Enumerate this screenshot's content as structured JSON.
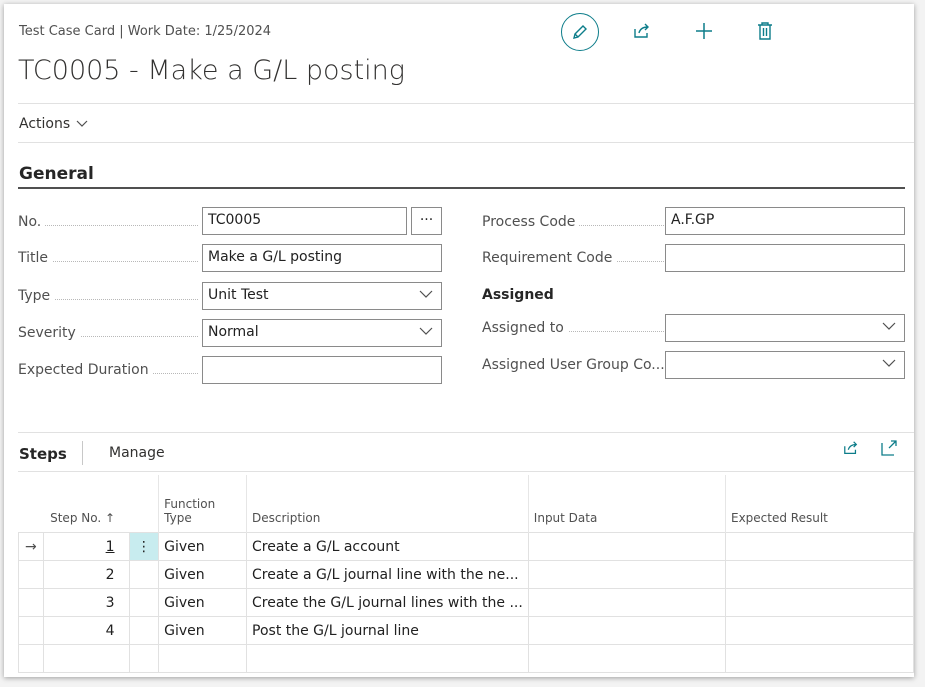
{
  "header": {
    "breadcrumb": "Test Case Card | Work Date: 1/25/2024",
    "title": "TC0005 - Make a G/L posting"
  },
  "actions_label": "Actions",
  "section_title": "General",
  "fields_left": [
    {
      "label": "No.",
      "value": "TC0005"
    },
    {
      "label": "Title",
      "value": "Make a G/L posting"
    },
    {
      "label": "Type",
      "value": "Unit Test"
    },
    {
      "label": "Severity",
      "value": "Normal"
    },
    {
      "label": "Expected Duration",
      "value": ""
    }
  ],
  "fields_right": [
    {
      "label": "Process Code",
      "value": "A.F.GP"
    },
    {
      "label": "Requirement Code",
      "value": ""
    },
    {
      "label": "Assigned to",
      "value": ""
    },
    {
      "label": "Assigned User Group Co...",
      "value": ""
    }
  ],
  "assigned_heading": "Assigned",
  "lookup_button": "···",
  "steps": {
    "title": "Steps",
    "manage": "Manage",
    "columns": [
      "Step No. ↑",
      "Function Type",
      "Description",
      "Input Data",
      "Expected Result"
    ],
    "rows": [
      {
        "indicator": "→",
        "step_no": "1",
        "menu": "⋮",
        "function_type": "Given",
        "description": "Create a G/L account",
        "input_data": "",
        "expected_result": ""
      },
      {
        "indicator": "",
        "step_no": "2",
        "menu": "",
        "function_type": "Given",
        "description": "Create a G/L journal line with the ne...",
        "input_data": "",
        "expected_result": ""
      },
      {
        "indicator": "",
        "step_no": "3",
        "menu": "",
        "function_type": "Given",
        "description": "Create the G/L journal lines with the ...",
        "input_data": "",
        "expected_result": ""
      },
      {
        "indicator": "",
        "step_no": "4",
        "menu": "",
        "function_type": "Given",
        "description": "Post the G/L journal line",
        "input_data": "",
        "expected_result": ""
      },
      {
        "indicator": "",
        "step_no": "",
        "menu": "",
        "function_type": "",
        "description": "",
        "input_data": "",
        "expected_result": ""
      }
    ]
  },
  "colors": {
    "accent": "#0d7d8a",
    "selected_cell": "#c8ecef"
  }
}
